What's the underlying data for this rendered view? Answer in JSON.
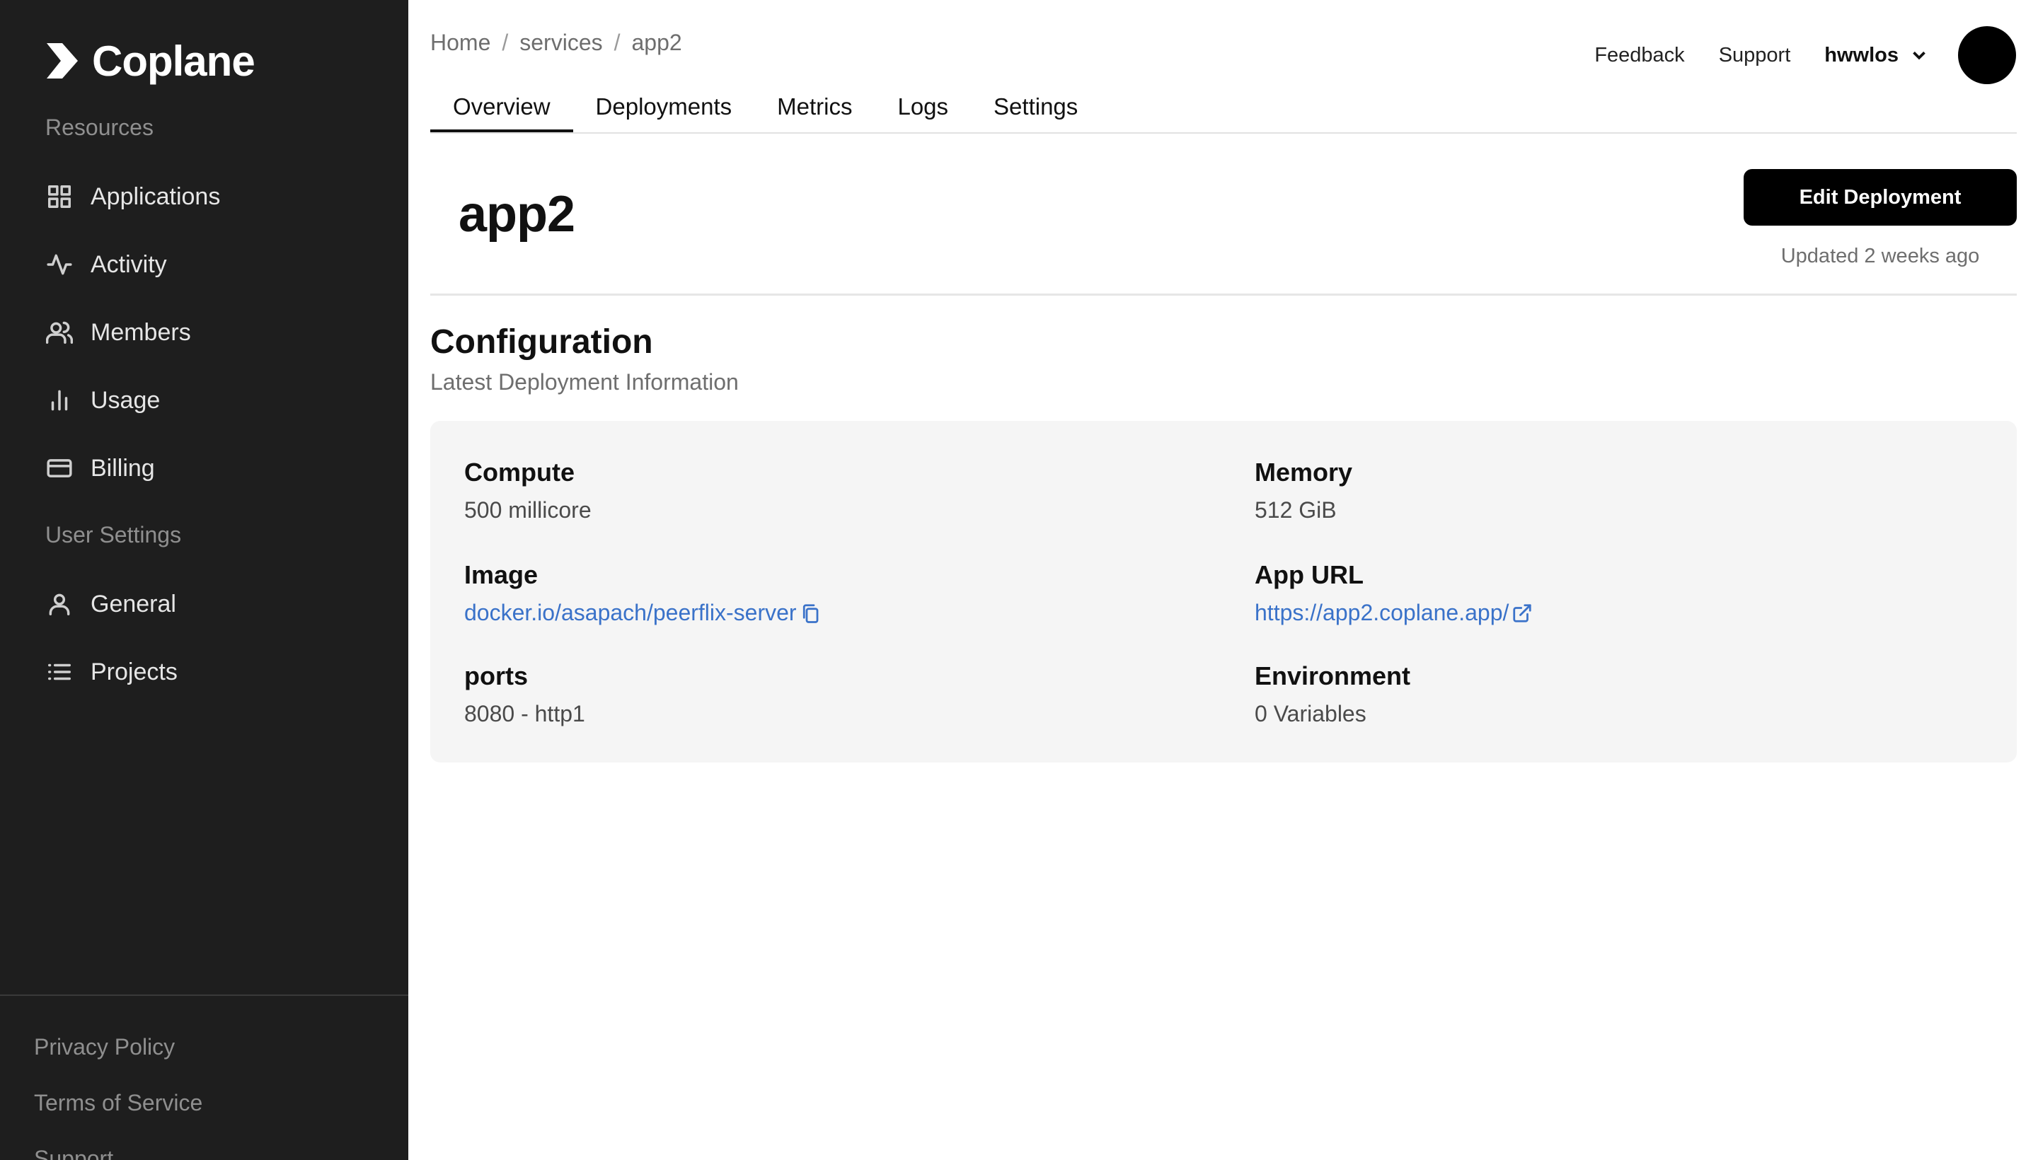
{
  "brand": {
    "name": "Coplane"
  },
  "sidebar": {
    "sections": {
      "resources": "Resources",
      "user_settings": "User Settings"
    },
    "items": [
      {
        "label": "Applications",
        "icon": "grid-icon"
      },
      {
        "label": "Activity",
        "icon": "activity-icon"
      },
      {
        "label": "Members",
        "icon": "users-icon"
      },
      {
        "label": "Usage",
        "icon": "bar-chart-icon"
      },
      {
        "label": "Billing",
        "icon": "credit-card-icon"
      },
      {
        "label": "General",
        "icon": "user-icon"
      },
      {
        "label": "Projects",
        "icon": "list-icon"
      }
    ],
    "footer": {
      "privacy": "Privacy Policy",
      "terms": "Terms of Service",
      "support": "Support"
    }
  },
  "breadcrumb": [
    "Home",
    "services",
    "app2"
  ],
  "breadcrumb_sep": "/",
  "tabs": [
    "Overview",
    "Deployments",
    "Metrics",
    "Logs",
    "Settings"
  ],
  "header": {
    "feedback": "Feedback",
    "support": "Support",
    "username": "hwwlos"
  },
  "page": {
    "title": "app2",
    "edit_button": "Edit Deployment",
    "updated": "Updated 2 weeks ago"
  },
  "configuration": {
    "title": "Configuration",
    "subtitle": "Latest Deployment Information",
    "compute": {
      "label": "Compute",
      "value": "500 millicore"
    },
    "memory": {
      "label": "Memory",
      "value": "512 GiB"
    },
    "image": {
      "label": "Image",
      "value": "docker.io/asapach/peerflix-server"
    },
    "app_url": {
      "label": "App URL",
      "value": "https://app2.coplane.app/"
    },
    "ports": {
      "label": "ports",
      "value": "8080 - http1"
    },
    "environment": {
      "label": "Environment",
      "value": "0 Variables"
    }
  },
  "colors": {
    "sidebar_bg": "#1e1e1e",
    "link": "#3a72c9",
    "primary_button": "#000000"
  }
}
